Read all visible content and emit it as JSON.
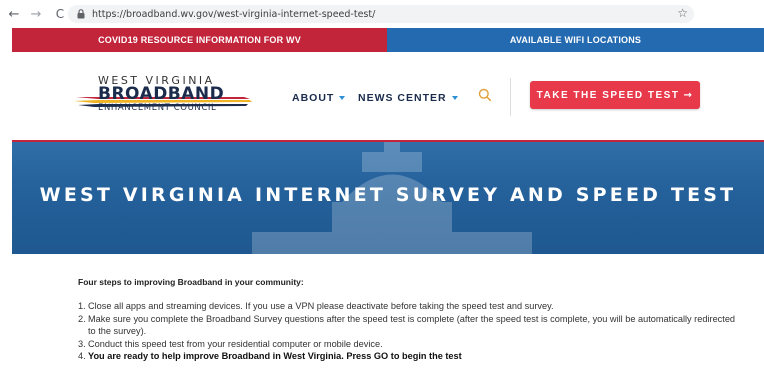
{
  "browser": {
    "back": "←",
    "forward": "→",
    "reload": "C",
    "url": "https://broadband.wv.gov/west-virginia-internet-speed-test/",
    "star": "☆"
  },
  "topbar": {
    "covid": "COVID19 RESOURCE INFORMATION FOR WV",
    "wifi": "AVAILABLE WIFI LOCATIONS",
    "colors": {
      "covid_bg": "#c2243a",
      "wifi_bg": "#236ab1"
    }
  },
  "logo": {
    "line1": "WEST VIRGINIA",
    "line2": "BROADBAND",
    "line3": "ENHANCEMENT COUNCIL"
  },
  "nav": {
    "about": "ABOUT",
    "news": "NEWS CENTER",
    "search_icon": "search-icon",
    "cta": "TAKE THE SPEED TEST",
    "cta_arrow": "→",
    "cta_color": "#e8394b"
  },
  "hero": {
    "title": "WEST VIRGINIA INTERNET SURVEY AND SPEED TEST",
    "bg_color": "#24609a"
  },
  "content": {
    "intro": "Four steps to improving Broadband in your community:",
    "steps": [
      {
        "num": "1.",
        "text": "Close all apps and streaming devices. If you use a VPN please deactivate before taking the speed test and survey."
      },
      {
        "num": "2.",
        "text": "Make sure you complete the Broadband Survey questions after the speed test is complete (after the speed test is complete, you will be automatically redirected to the survey)."
      },
      {
        "num": "3.",
        "text": "Conduct this speed test from your residential computer or mobile device."
      },
      {
        "num": "4.",
        "text": "You are ready to help improve Broadband in West Virginia. Press GO to begin the test"
      }
    ]
  }
}
